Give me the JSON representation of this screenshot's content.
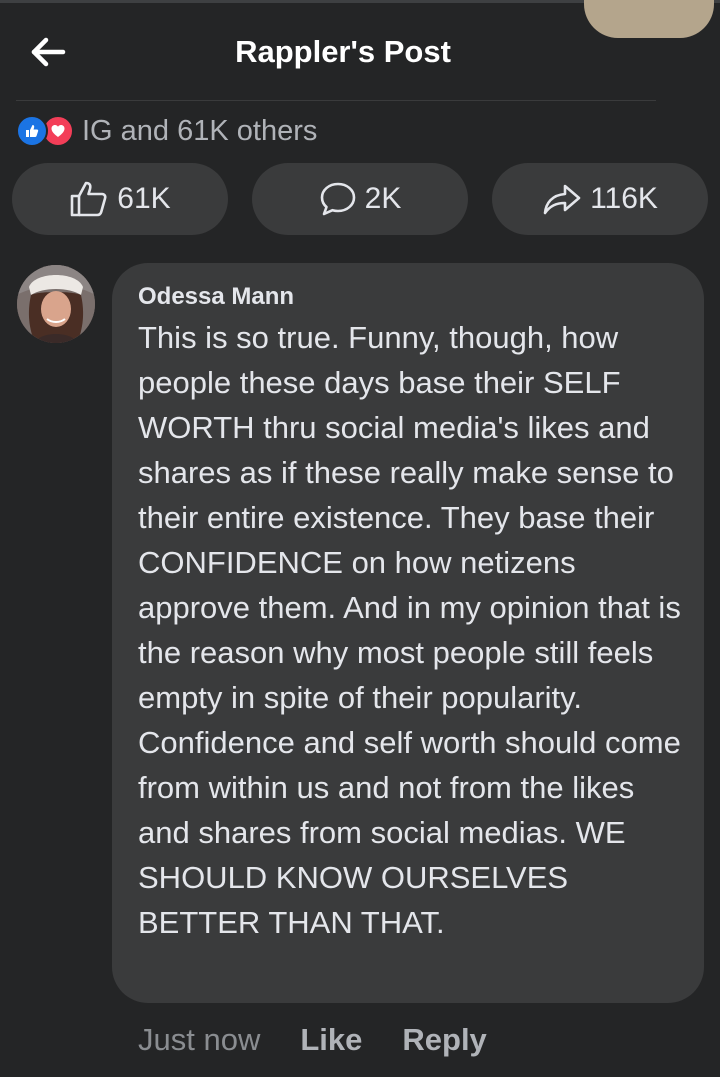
{
  "header": {
    "title": "Rappler's Post",
    "back_icon": "arrow-left-icon"
  },
  "reactions": {
    "icons": [
      "like-reaction-icon",
      "love-reaction-icon"
    ],
    "summary": "IG and 61K others",
    "colors": {
      "like": "#1b74e4",
      "love": "#f33e58"
    }
  },
  "actions": {
    "like": {
      "icon": "thumbs-up-icon",
      "count": "61K"
    },
    "comment": {
      "icon": "comment-bubble-icon",
      "count": "2K"
    },
    "share": {
      "icon": "share-arrow-icon",
      "count": "116K"
    }
  },
  "comment": {
    "author": "Odessa Mann",
    "text": "This is so true. Funny, though, how people these days base their SELF WORTH thru social media's likes and shares as if these really make sense to their entire existence. They base their CONFIDENCE on how netizens approve them. And in my opinion that is the reason why most people still feels empty in spite of their popularity. Confidence and self worth should come from within us and not from the likes and shares from social medias. WE SHOULD KNOW OURSELVES BETTER THAN THAT.",
    "timestamp": "Just now",
    "like_label": "Like",
    "reply_label": "Reply"
  },
  "theme": {
    "background": "#242526",
    "surface": "#3a3b3c",
    "text": "#e4e6eb",
    "muted": "#b0b3b8"
  }
}
